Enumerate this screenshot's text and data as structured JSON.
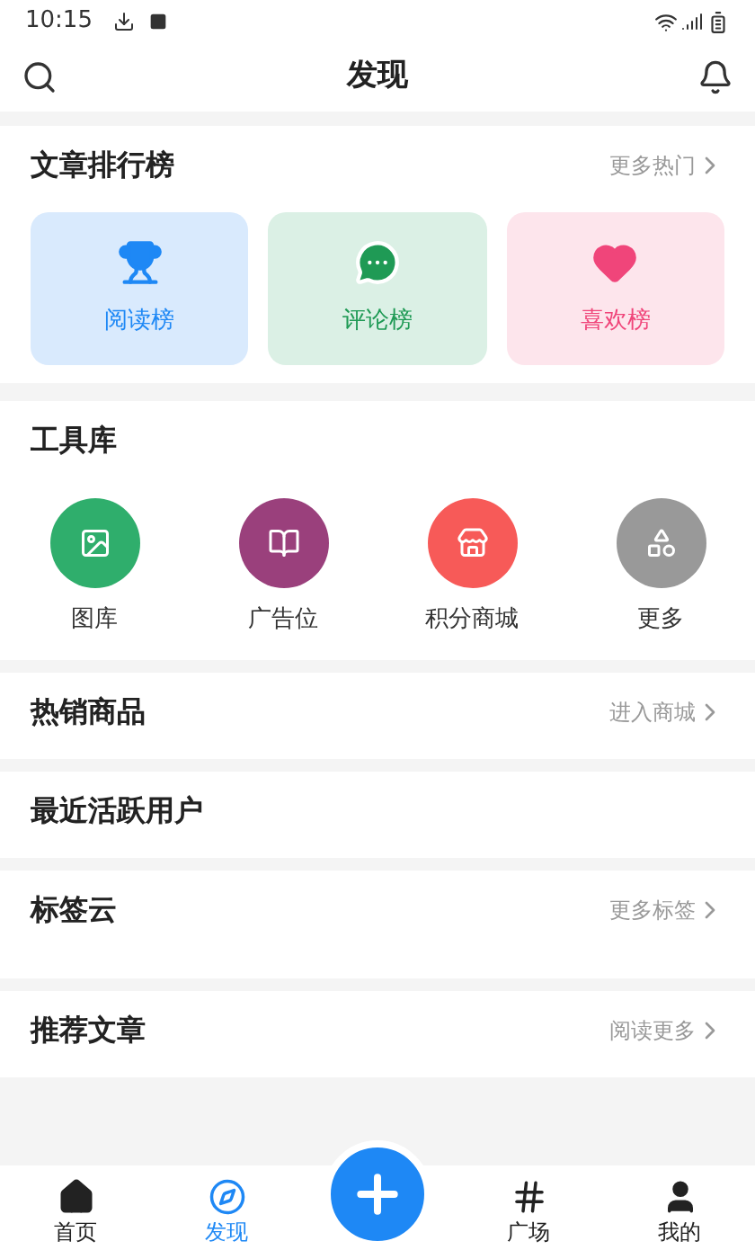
{
  "status_bar": {
    "time": "10:15"
  },
  "header": {
    "title": "发现"
  },
  "ranking": {
    "title": "文章排行榜",
    "link": "更多热门",
    "cards": [
      {
        "label": "阅读榜",
        "kind": "read"
      },
      {
        "label": "评论榜",
        "kind": "comment"
      },
      {
        "label": "喜欢榜",
        "kind": "like"
      }
    ]
  },
  "tools": {
    "title": "工具库",
    "items": [
      {
        "label": "图库",
        "kind": "gallery"
      },
      {
        "label": "广告位",
        "kind": "ads"
      },
      {
        "label": "积分商城",
        "kind": "shop"
      },
      {
        "label": "更多",
        "kind": "more"
      }
    ]
  },
  "sections": [
    {
      "title": "热销商品",
      "link": "进入商城",
      "kind": "short"
    },
    {
      "title": "最近活跃用户",
      "kind": "short"
    },
    {
      "title": "标签云",
      "link": "更多标签",
      "kind": "tall"
    },
    {
      "title": "推荐文章",
      "link": "阅读更多",
      "kind": "short"
    }
  ],
  "bottom_nav": [
    {
      "label": "首页",
      "kind": "home",
      "selected": false
    },
    {
      "label": "发现",
      "kind": "discover",
      "selected": true
    },
    {
      "kind": "add"
    },
    {
      "label": "广场",
      "kind": "square",
      "selected": false
    },
    {
      "label": "我的",
      "kind": "me",
      "selected": false
    }
  ]
}
